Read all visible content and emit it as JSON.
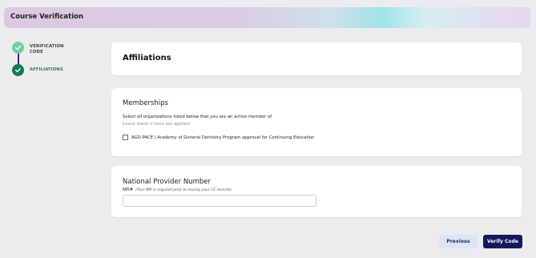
{
  "header": {
    "title": "Course Verification"
  },
  "stepper": {
    "steps": [
      {
        "label": "VERIFICATION CODE",
        "status": "completed",
        "icon": "check-icon"
      },
      {
        "label": "AFFILIATIONS",
        "status": "current",
        "icon": "check-icon"
      }
    ]
  },
  "affiliations": {
    "title": "Affiliations"
  },
  "memberships": {
    "title": "Memberships",
    "instruction": "Select all organizations listed below that you are an active member of",
    "hint": "Leave blank if none are applied",
    "options": [
      {
        "label": "AGD-PACE | Academy of General Dentistry Program approval for Continuing Education",
        "checked": false
      }
    ]
  },
  "npi": {
    "title": "National Provider Number",
    "label": "NPI#",
    "note": "(Your NPI is required prior to issuing your CE records)",
    "value": ""
  },
  "actions": {
    "previous_label": "Previous",
    "verify_label": "Verify Code"
  },
  "colors": {
    "step_completed": "#6ed29a",
    "step_current": "#0f7b52",
    "connector": "#2e2e8f",
    "primary_button": "#14185f",
    "secondary_button": "#dde5f4"
  }
}
